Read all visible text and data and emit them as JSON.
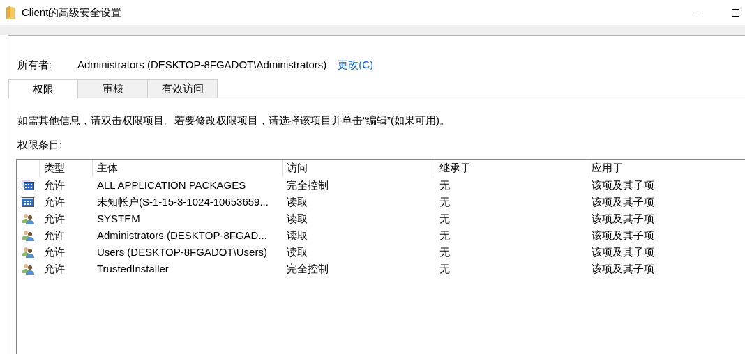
{
  "window": {
    "title": "Client的高级安全设置"
  },
  "owner": {
    "label": "所有者:",
    "value": "Administrators (DESKTOP-8FGADOT\\Administrators)",
    "change_link": "更改(C)"
  },
  "tabs": [
    {
      "label": "权限",
      "selected": true
    },
    {
      "label": "审核",
      "selected": false
    },
    {
      "label": "有效访问",
      "selected": false
    }
  ],
  "info_text": "如需其他信息，请双击权限项目。若要修改权限项目，请选择该项目并单击“编辑”(如果可用)。",
  "list_label": "权限条目:",
  "table": {
    "columns": [
      "类型",
      "主体",
      "访问",
      "继承于",
      "应用于"
    ],
    "rows": [
      {
        "kind": "packages",
        "type": "允许",
        "principal": "ALL APPLICATION PACKAGES",
        "access": "完全控制",
        "inherited_from": "无",
        "applies_to": "该项及其子项"
      },
      {
        "kind": "account",
        "type": "允许",
        "principal": "未知帐户(S-1-15-3-1024-10653659...",
        "access": "读取",
        "inherited_from": "无",
        "applies_to": "该项及其子项"
      },
      {
        "kind": "group",
        "type": "允许",
        "principal": "SYSTEM",
        "access": "读取",
        "inherited_from": "无",
        "applies_to": "该项及其子项"
      },
      {
        "kind": "group",
        "type": "允许",
        "principal": "Administrators (DESKTOP-8FGAD...",
        "access": "读取",
        "inherited_from": "无",
        "applies_to": "该项及其子项"
      },
      {
        "kind": "group",
        "type": "允许",
        "principal": "Users (DESKTOP-8FGADOT\\Users)",
        "access": "读取",
        "inherited_from": "无",
        "applies_to": "该项及其子项"
      },
      {
        "kind": "group",
        "type": "允许",
        "principal": "TrustedInstaller",
        "access": "完全控制",
        "inherited_from": "无",
        "applies_to": "该项及其子项"
      }
    ]
  }
}
